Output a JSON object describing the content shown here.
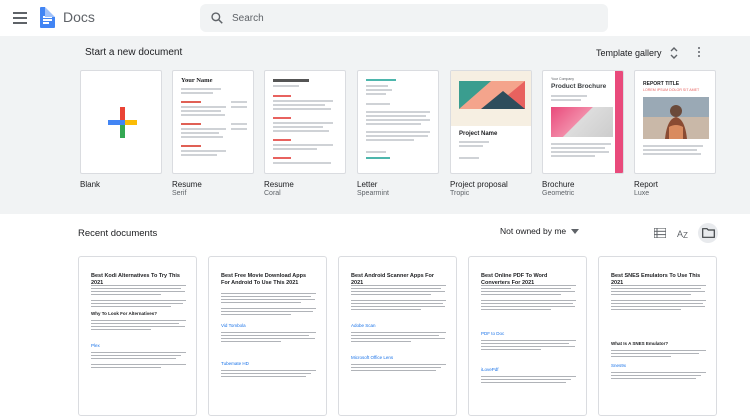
{
  "header": {
    "app_title": "Docs",
    "search_placeholder": "Search"
  },
  "templates": {
    "section_title": "Start a new document",
    "gallery_label": "Template gallery",
    "items": [
      {
        "name": "Blank",
        "sub": ""
      },
      {
        "name": "Resume",
        "sub": "Serif",
        "preview_heading": "Your Name"
      },
      {
        "name": "Resume",
        "sub": "Coral"
      },
      {
        "name": "Letter",
        "sub": "Spearmint"
      },
      {
        "name": "Project proposal",
        "sub": "Tropic",
        "preview_heading": "Project Name"
      },
      {
        "name": "Brochure",
        "sub": "Geometric",
        "preview_heading": "Product Brochure",
        "preview_brand": "Your Company"
      },
      {
        "name": "Report",
        "sub": "Luxe",
        "preview_heading": "REPORT TITLE",
        "preview_tagline": "LOREM IPSUM DOLOR SIT AMET"
      }
    ]
  },
  "recent": {
    "title": "Recent documents",
    "owner_filter": "Not owned by me",
    "docs": [
      {
        "title": "Best Kodi Alternatives To Try This 2021",
        "subheads": [
          "Why To Look For Alternatives?",
          "Plex"
        ]
      },
      {
        "title": "Best Free Movie Download Apps For Android To Use This 2021",
        "subheads": [
          "Vid Tombola",
          "Tubemate HD"
        ]
      },
      {
        "title": "Best Android Scanner Apps For 2021",
        "subheads": [
          "Adobe Scan",
          "Microsoft Office Lens"
        ]
      },
      {
        "title": "Best Online PDF To Word Converters For 2021",
        "subheads": [
          "PDF to Doc",
          "iLovePdf"
        ]
      },
      {
        "title": "Best SNES Emulators To Use This 2021",
        "subheads": [
          "What Is A SNES Emulator?",
          "Snes9x"
        ]
      }
    ]
  },
  "colors": {
    "brand_blue": "#4285f4",
    "gallery_bg": "#f1f3f4",
    "coral": "#e8625f",
    "brochure_pink": "#e94a7b"
  }
}
